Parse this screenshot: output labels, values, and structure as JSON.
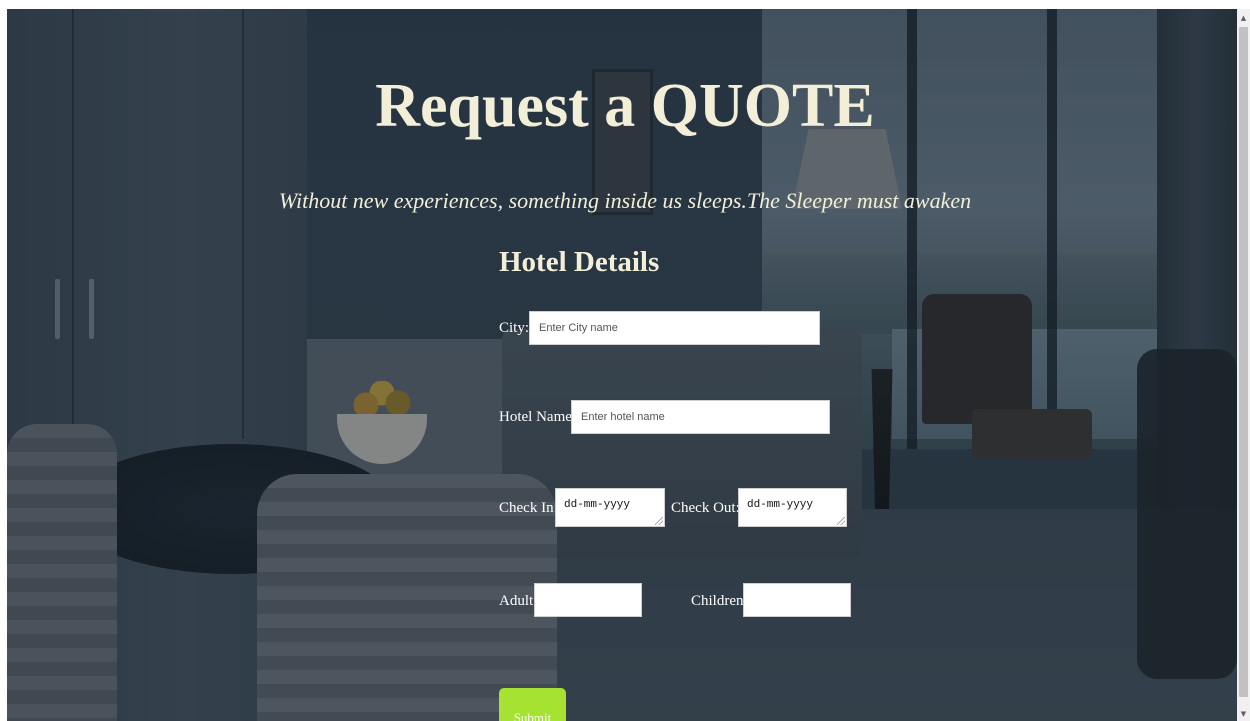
{
  "page": {
    "heading": "Request a QUOTE",
    "tagline": "Without new experiences, something inside us sleeps.The Sleeper must awaken"
  },
  "form": {
    "section_title": "Hotel Details",
    "city": {
      "label": "City:",
      "placeholder": "Enter City name"
    },
    "hotel_name": {
      "label": "Hotel Name:",
      "placeholder": "Enter hotel name"
    },
    "check_in": {
      "label": "Check In:",
      "value": "dd-mm-yyyy"
    },
    "check_out": {
      "label": "Check Out:",
      "value": "dd-mm-yyyy"
    },
    "adult": {
      "label": "Adult:"
    },
    "children": {
      "label": "Children:"
    },
    "submit_label": "Submit"
  },
  "icons": {
    "scroll_up": "▲",
    "scroll_down": "▼"
  },
  "colors": {
    "heading_text": "#f2eed8",
    "submit_button": "#a6e232"
  }
}
